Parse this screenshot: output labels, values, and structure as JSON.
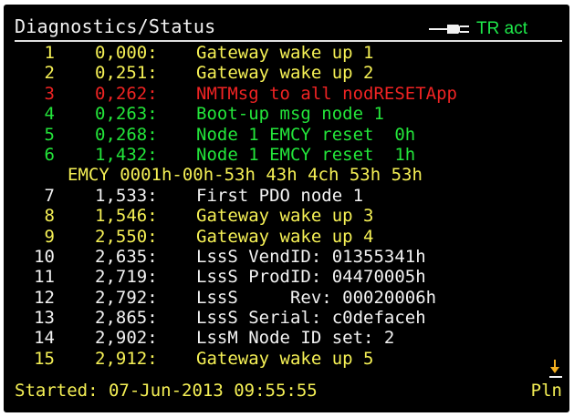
{
  "header": {
    "title": "Diagnostics/Status",
    "tr_status": "TR act",
    "connector_icon": "connector-plug-icon"
  },
  "log": [
    {
      "num": "1",
      "time": "0,000:",
      "msg": "Gateway wake up 1",
      "color": "yellow"
    },
    {
      "num": "2",
      "time": "0,251:",
      "msg": "Gateway wake up 2",
      "color": "yellow"
    },
    {
      "num": "3",
      "time": "0,262:",
      "msg": "NMTMsg to all nodRESETApp",
      "color": "red"
    },
    {
      "num": "4",
      "time": "0,263:",
      "msg": "Boot-up msg node 1",
      "color": "green"
    },
    {
      "num": "5",
      "time": "0,268:",
      "msg": "Node 1 EMCY reset  0h",
      "color": "green"
    },
    {
      "num": "6",
      "time": "1,432:",
      "msg": "Node 1 EMCY reset  1h",
      "color": "green"
    },
    {
      "num": "",
      "time": "",
      "msg": "EMCY 0001h-00h-53h 43h 4ch 53h 53h",
      "color": "yellow",
      "extra": true
    },
    {
      "num": "7",
      "time": "1,533:",
      "msg": "First PDO node 1",
      "color": "white"
    },
    {
      "num": "8",
      "time": "1,546:",
      "msg": "Gateway wake up 3",
      "color": "yellow"
    },
    {
      "num": "9",
      "time": "2,550:",
      "msg": "Gateway wake up 4",
      "color": "yellow"
    },
    {
      "num": "10",
      "time": "2,635:",
      "msg": "LssS VendID: 01355341h",
      "color": "white"
    },
    {
      "num": "11",
      "time": "2,719:",
      "msg": "LssS ProdID: 04470005h",
      "color": "white"
    },
    {
      "num": "12",
      "time": "2,792:",
      "msg": "LssS     Rev: 00020006h",
      "color": "white"
    },
    {
      "num": "13",
      "time": "2,865:",
      "msg": "LssS Serial: c0defaceh",
      "color": "white"
    },
    {
      "num": "14",
      "time": "2,902:",
      "msg": "LssM Node ID set: 2",
      "color": "white"
    },
    {
      "num": "15",
      "time": "2,912:",
      "msg": "Gateway wake up 5",
      "color": "yellow"
    }
  ],
  "footer": {
    "started_label": "Started:",
    "started_value": "07-Jun-2013 09:55:55",
    "pln": "Pln",
    "scroll_icon": "scroll-down-arrow-icon"
  },
  "colors": {
    "background": "#000000",
    "white": "#f2f2f2",
    "yellow": "#f5f055",
    "green": "#23e53a",
    "red": "#ee2323",
    "tr_green": "#1ee84a"
  }
}
